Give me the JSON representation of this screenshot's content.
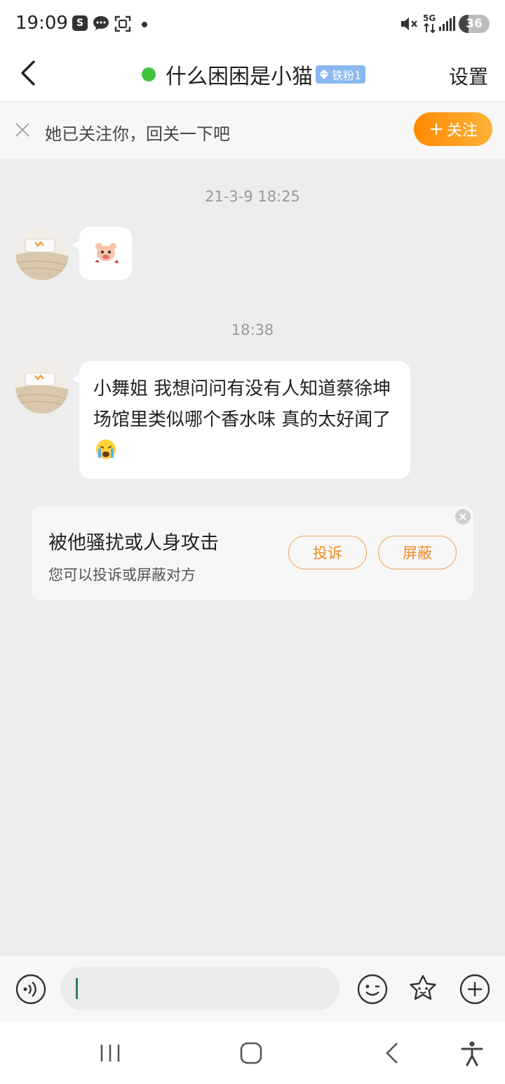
{
  "status_bar": {
    "time": "19:09",
    "network": "5G",
    "battery": "36",
    "icons": [
      "s-icon",
      "chat-icon",
      "scan-icon",
      "mute-icon",
      "signal-icon"
    ]
  },
  "navbar": {
    "title": "什么困困是小猫",
    "badge": "铁粉1",
    "settings_label": "设置",
    "online_color": "#3ec43e"
  },
  "follow_bar": {
    "text": "她已关注你，回关一下吧",
    "button_label": "关注",
    "accent": "#ff9a1a"
  },
  "messages": [
    {
      "timestamp": "21-3-9 18:25",
      "type": "sticker"
    },
    {
      "timestamp": "18:38",
      "type": "text",
      "text": "小舞姐 我想问问有没有人知道蔡徐坤场馆里类似哪个香水味 真的太好闻了"
    }
  ],
  "notice": {
    "title": "被他骚扰或人身攻击",
    "subtitle": "您可以投诉或屏蔽对方",
    "report_label": "投诉",
    "block_label": "屏蔽"
  },
  "input": {
    "placeholder": ""
  }
}
